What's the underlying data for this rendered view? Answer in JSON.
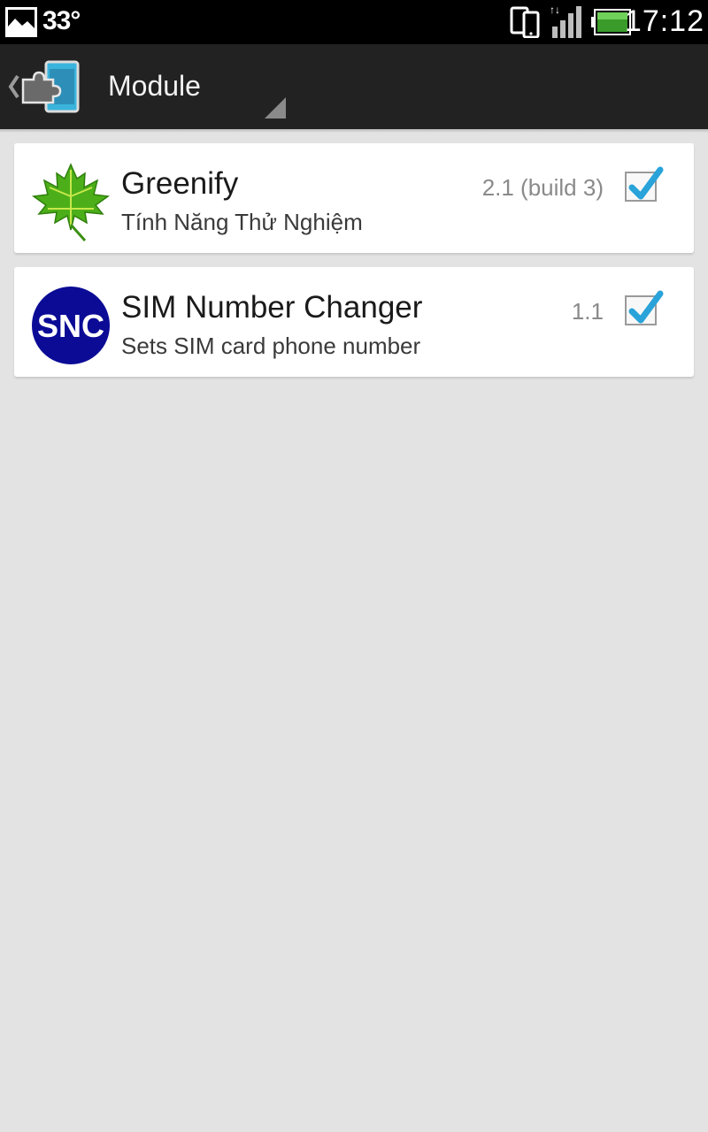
{
  "status_bar": {
    "temperature": "33°",
    "time": "17:12",
    "icons": [
      "gallery-icon",
      "phone-icon",
      "signal-icon",
      "battery-icon"
    ]
  },
  "action_bar": {
    "title": "Module",
    "app_icon": "xposed-puzzle-icon"
  },
  "modules": [
    {
      "name": "Greenify",
      "description": "Tính Năng Thử Nghiệm",
      "version": "2.1 (build 3)",
      "enabled": true,
      "icon": "maple-leaf-icon"
    },
    {
      "name": "SIM Number Changer",
      "description": "Sets SIM card phone number",
      "version": "1.1",
      "enabled": true,
      "icon": "snc-logo-icon",
      "icon_text": "SNC"
    }
  ],
  "colors": {
    "status_bar": "#000000",
    "action_bar": "#222222",
    "background": "#e3e3e3",
    "card": "#ffffff",
    "check_accent": "#29a3d9",
    "snc_blue": "#0b0b96",
    "leaf_green": "#4caf1a"
  }
}
